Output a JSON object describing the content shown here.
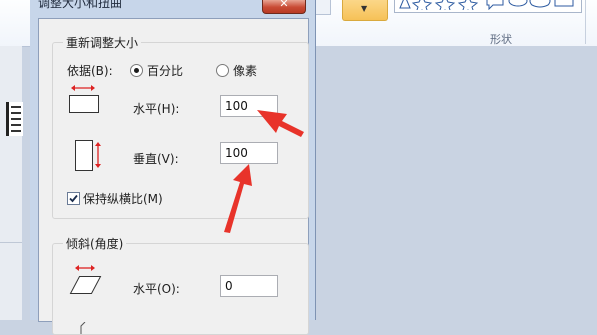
{
  "ribbon": {
    "shapes_group_label": "形状"
  },
  "dialog": {
    "title": "调整大小和扭曲",
    "close_glyph": "✕",
    "resize": {
      "group_title": "重新调整大小",
      "by_label": "依据(B):",
      "option_percent": "百分比",
      "option_pixels": "像素",
      "selected_option": "百分比",
      "horizontal_label": "水平(H):",
      "horizontal_value": "100",
      "vertical_label": "垂直(V):",
      "vertical_value": "100",
      "keep_ratio_label": "保持纵横比(M)",
      "keep_ratio_checked": true
    },
    "skew": {
      "group_title": "倾斜(角度)",
      "horizontal_label": "水平(O):",
      "horizontal_value": "0"
    }
  },
  "icons": {
    "horizontal_resize": "horizontal-resize-icon",
    "vertical_resize": "vertical-resize-icon",
    "horizontal_skew": "horizontal-skew-icon"
  },
  "colors": {
    "annotation_arrow": "#e8332a",
    "dialog_frame": "#c7d6ea",
    "close_button": "#c94b35",
    "color_dropdown": "#f6c157"
  }
}
